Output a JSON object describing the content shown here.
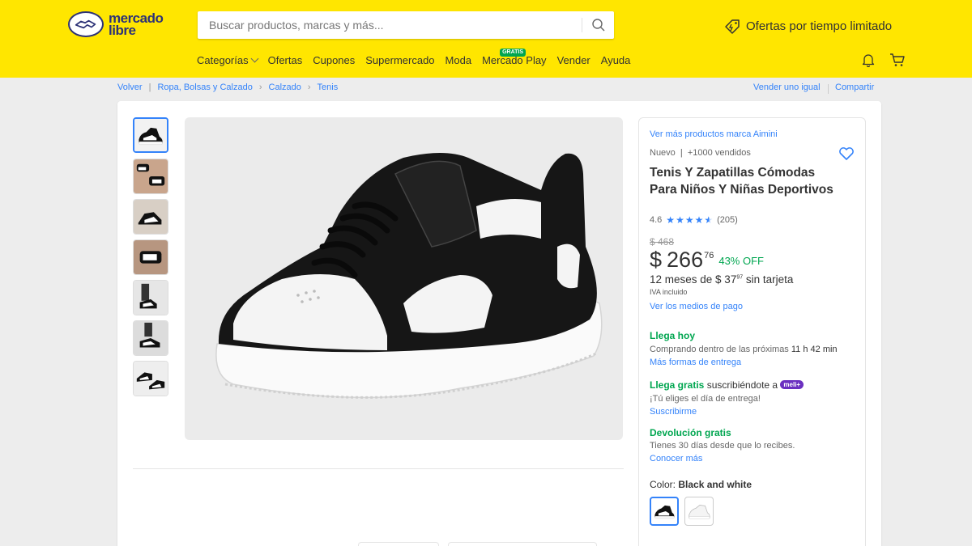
{
  "header": {
    "logo_line1": "mercado",
    "logo_line2": "libre",
    "search_placeholder": "Buscar productos, marcas y más...",
    "promo_text": "Ofertas por tiempo limitado",
    "nav": [
      "Categorías",
      "Ofertas",
      "Cupones",
      "Supermercado",
      "Moda",
      "Mercado Play",
      "Vender",
      "Ayuda"
    ],
    "gratis_badge": "GRATIS"
  },
  "breadcrumb": {
    "back": "Volver",
    "items": [
      "Ropa, Bolsas y Calzado",
      "Calzado",
      "Tenis"
    ],
    "sell_same": "Vender uno igual",
    "share": "Compartir"
  },
  "gallery": {
    "thumb_count": 7
  },
  "product": {
    "brand_link": "Ver más productos marca Aimini",
    "condition": "Nuevo  |  +1000 vendidos",
    "title": "Tenis Y Zapatillas Cómodas Para Niños Y Niñas Deportivos",
    "rating": "4.6",
    "stars": 4.6,
    "reviews": "(205)",
    "old_price": "$ 468",
    "price_currency": "$",
    "price_int": "266",
    "price_cents": "76",
    "discount": "43% OFF",
    "installments_pre": "12 meses de $ 37",
    "installments_cents": "97",
    "installments_post": " sin tarjeta",
    "iva": "IVA incluido",
    "pay_link": "Ver los medios de pago"
  },
  "shipping": {
    "today_title": "Llega hoy",
    "today_pre": "Comprando dentro de las próximas ",
    "today_time": "11 h 42 min",
    "more_ways": "Más formas de entrega",
    "free_title": "Llega gratis",
    "free_rest": " suscribiéndote a ",
    "meli_badge": "meli+",
    "free_sub": "¡Tú eliges el día de entrega!",
    "subscribe": "Suscribirme",
    "return_title": "Devolución gratis",
    "return_sub": "Tienes 30 días desde que lo recibes.",
    "learn_more": "Conocer más"
  },
  "color": {
    "label": "Color: ",
    "value": "Black and white"
  },
  "colors": {
    "yellow": "#ffe600",
    "blue": "#3483fa",
    "green": "#00a650",
    "purple": "#6b2fc0"
  }
}
